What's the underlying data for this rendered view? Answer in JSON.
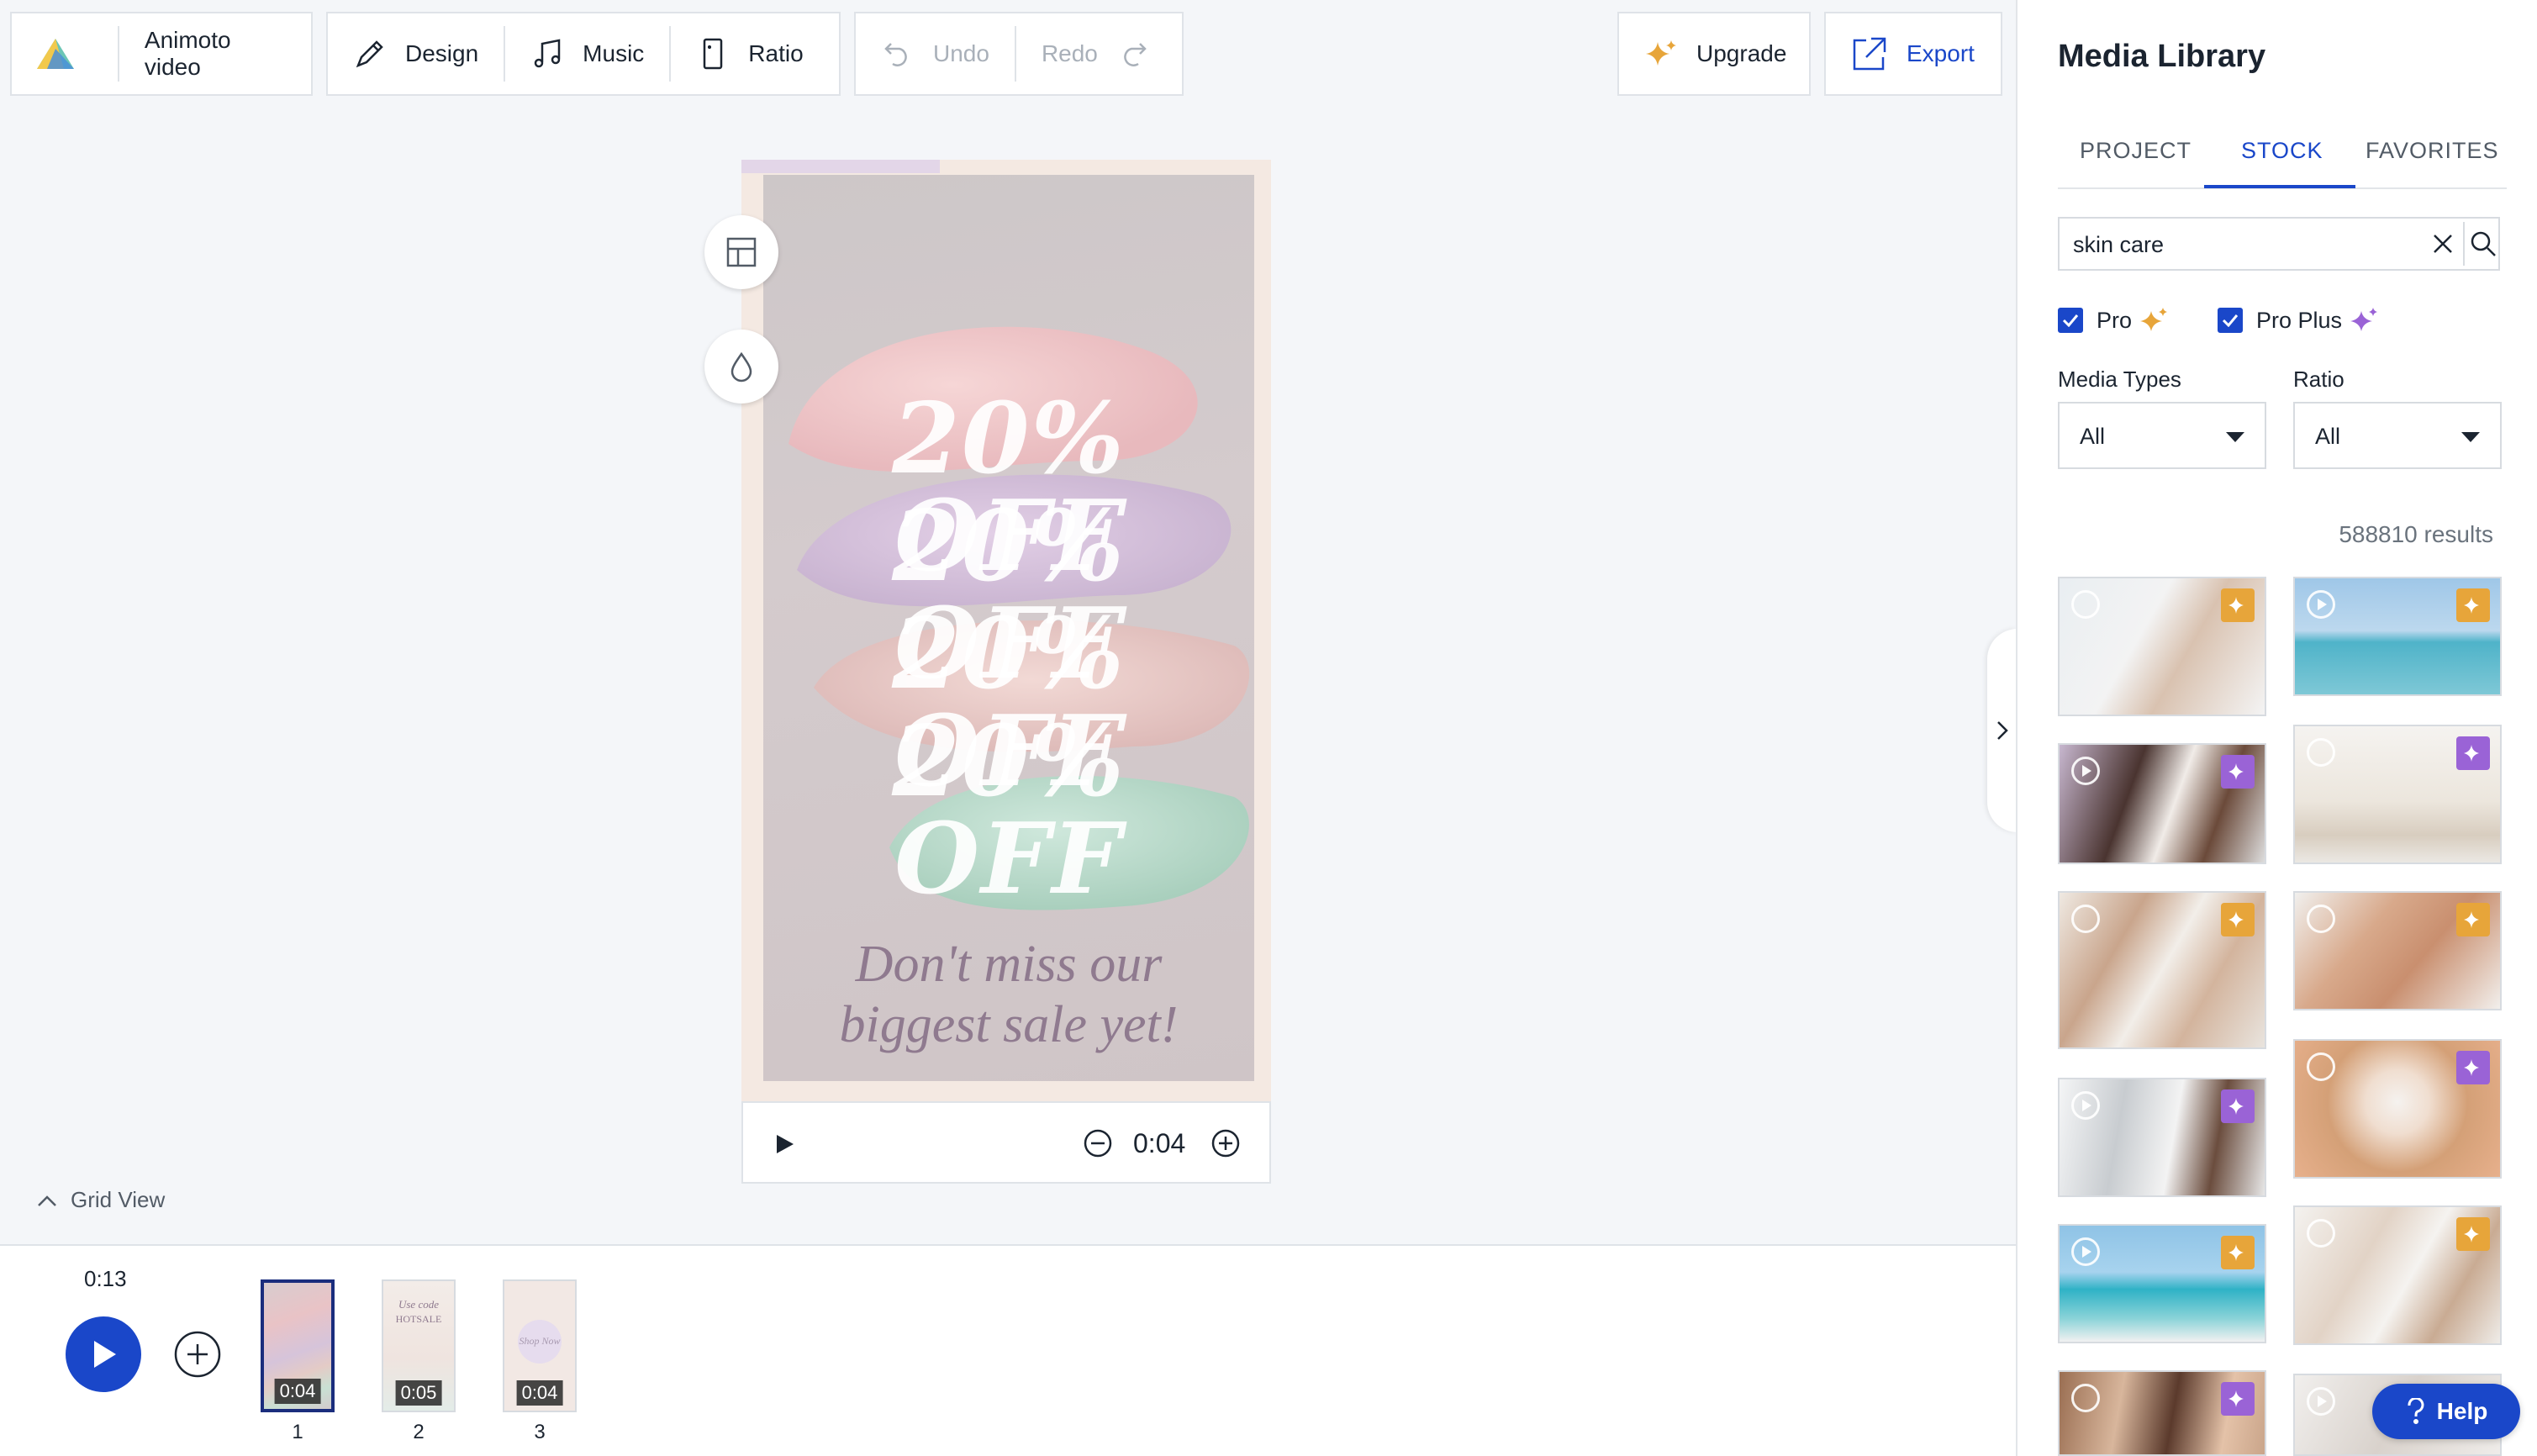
{
  "toolbar": {
    "project_title": "Animoto video",
    "design_label": "Design",
    "music_label": "Music",
    "ratio_label": "Ratio",
    "undo_label": "Undo",
    "redo_label": "Redo",
    "upgrade_label": "Upgrade",
    "export_label": "Export"
  },
  "canvas": {
    "offer_lines": [
      "20% OFF",
      "20% OFF",
      "20% OFF",
      "20% OFF"
    ],
    "tagline_line1": "Don't miss our",
    "tagline_line2": "biggest sale yet!",
    "block_duration": "0:04"
  },
  "timeline": {
    "grid_view_label": "Grid View",
    "total_duration": "0:13",
    "blocks": [
      {
        "number": "1",
        "duration": "0:04",
        "selected": true
      },
      {
        "number": "2",
        "duration": "0:05",
        "selected": false,
        "preview_line1": "Use code",
        "preview_line2": "HOTSALE"
      },
      {
        "number": "3",
        "duration": "0:04",
        "selected": false,
        "preview_line1": "Shop Now"
      }
    ]
  },
  "media_library": {
    "title": "Media Library",
    "tabs": [
      {
        "label": "PROJECT",
        "active": false
      },
      {
        "label": "STOCK",
        "active": true
      },
      {
        "label": "FAVORITES",
        "active": false
      }
    ],
    "search_value": "skin care",
    "filters": {
      "pro_label": "Pro",
      "pro_plus_label": "Pro Plus",
      "pro_checked": true,
      "pro_plus_checked": true,
      "media_types_label": "Media Types",
      "media_types_value": "All",
      "ratio_label": "Ratio",
      "ratio_value": "All"
    },
    "results_count": "588810 results",
    "help_label": "Help"
  },
  "colors": {
    "accent": "#1a47c9",
    "pro_badge": "#e7a53a",
    "pro_plus_badge": "#9a63d6",
    "play_button": "#1a47c9"
  }
}
